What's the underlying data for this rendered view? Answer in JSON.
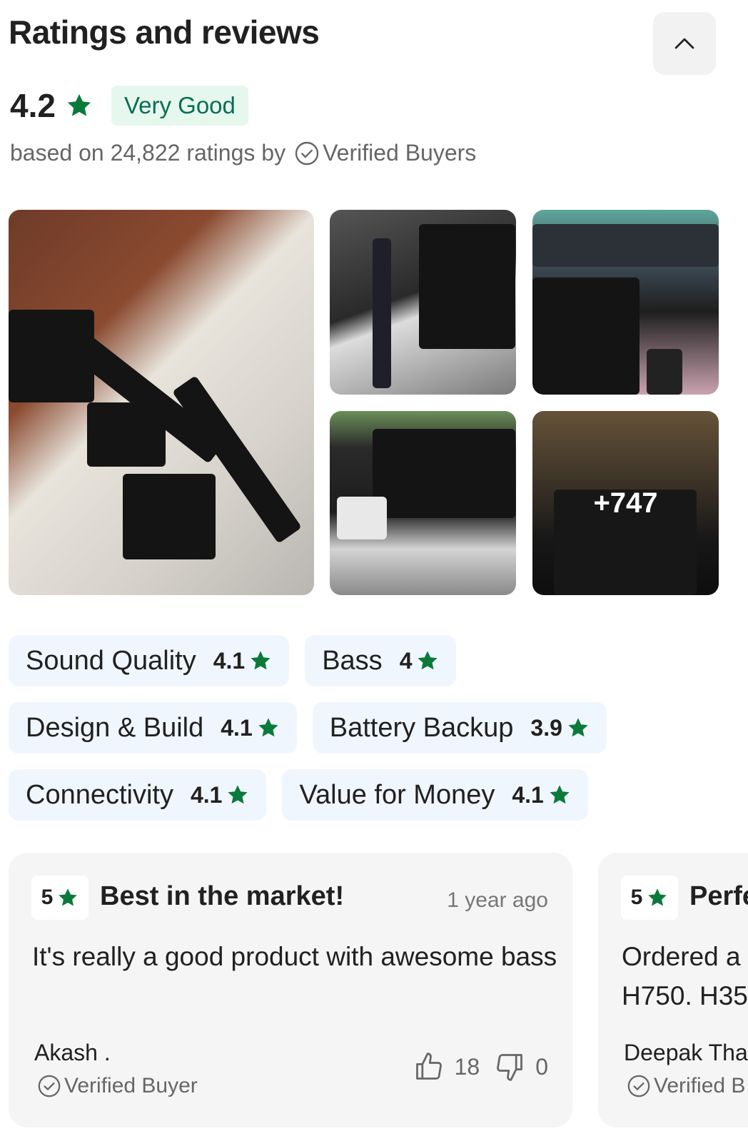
{
  "header": {
    "title": "Ratings and reviews"
  },
  "summary": {
    "rating": "4.2",
    "label": "Very Good",
    "based_prefix": "based on 24,822 ratings by",
    "verified_label": "Verified Buyers"
  },
  "gallery": {
    "more_count": "+747"
  },
  "attributes": [
    {
      "label": "Sound Quality",
      "score": "4.1"
    },
    {
      "label": "Bass",
      "score": "4"
    },
    {
      "label": "Design & Build",
      "score": "4.1"
    },
    {
      "label": "Battery Backup",
      "score": "3.9"
    },
    {
      "label": "Connectivity",
      "score": "4.1"
    },
    {
      "label": "Value for Money",
      "score": "4.1"
    }
  ],
  "reviews": [
    {
      "rating": "5",
      "title": "Best in the market!",
      "time": "1 year ago",
      "body": "It's really a good product with awesome bass",
      "author": "Akash .",
      "verified": "Verified Buyer",
      "likes": "18",
      "dislikes": "0"
    },
    {
      "rating": "5",
      "title": "Perfe",
      "body": "Ordered a H750. H35",
      "author": "Deepak Tha",
      "verified": "Verified B"
    }
  ],
  "colors": {
    "star_green": "#0a7a3a",
    "badge_bg": "#e6f7ee",
    "chip_bg": "#f0f6fe"
  },
  "icons": [
    "chevron-up-icon",
    "star-icon",
    "check-circle-icon",
    "thumbs-up-icon",
    "thumbs-down-icon"
  ]
}
